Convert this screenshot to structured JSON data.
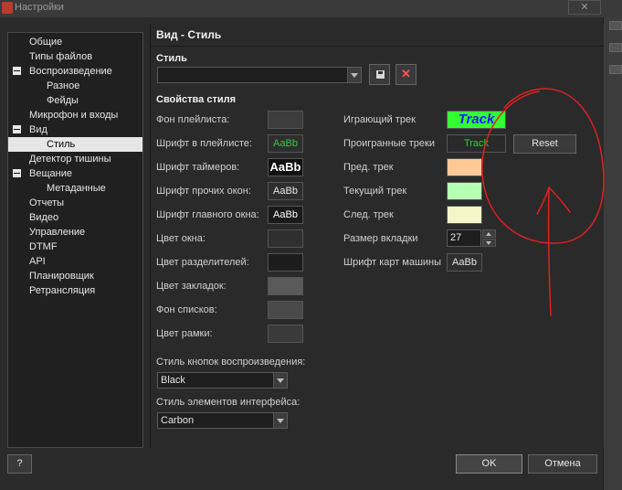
{
  "window": {
    "title": "Настройки",
    "close_icon": "close-icon"
  },
  "nav": {
    "items": [
      {
        "label": "Общие",
        "indent": 1
      },
      {
        "label": "Типы файлов",
        "indent": 1
      },
      {
        "label": "Воспроизведение",
        "indent": 1,
        "expanded": true
      },
      {
        "label": "Разное",
        "indent": 2
      },
      {
        "label": "Фейды",
        "indent": 2
      },
      {
        "label": "Микрофон и входы",
        "indent": 1
      },
      {
        "label": "Вид",
        "indent": 1,
        "expanded": true
      },
      {
        "label": "Стиль",
        "indent": 2,
        "selected": true
      },
      {
        "label": "Детектор тишины",
        "indent": 1
      },
      {
        "label": "Вещание",
        "indent": 1,
        "expanded": true
      },
      {
        "label": "Метаданные",
        "indent": 2
      },
      {
        "label": "Отчеты",
        "indent": 1
      },
      {
        "label": "Видео",
        "indent": 1
      },
      {
        "label": "Управление",
        "indent": 1
      },
      {
        "label": "DTMF",
        "indent": 1
      },
      {
        "label": "API",
        "indent": 1
      },
      {
        "label": "Планировщик",
        "indent": 1
      },
      {
        "label": "Ретрансляция",
        "indent": 1
      }
    ]
  },
  "page": {
    "title": "Вид - Стиль",
    "style_group_label": "Стиль",
    "style_combo_value": "",
    "props_group_label": "Свойства стиля"
  },
  "left_props": [
    {
      "label": "Фон плейлиста:",
      "kind": "swatch",
      "color": "#3d3d3d"
    },
    {
      "label": "Шрифт в плейлисте:",
      "kind": "font",
      "sample": "AaBb",
      "color": "#2ecc40",
      "bg": "#2e2e2e",
      "bold": false
    },
    {
      "label": "Шрифт таймеров:",
      "kind": "font",
      "sample": "AaBb",
      "color": "#ffffff",
      "bg": "#111111",
      "bold": true
    },
    {
      "label": "Шрифт прочих окон:",
      "kind": "font",
      "sample": "AaBb",
      "color": "#e6e6e6",
      "bg": "#2e2e2e",
      "bold": false
    },
    {
      "label": "Шрифт главного окна:",
      "kind": "font",
      "sample": "AaBb",
      "color": "#ffffff",
      "bg": "#1a1a1a",
      "bold": false
    },
    {
      "label": "Цвет окна:",
      "kind": "swatch",
      "color": "#2f2f2f"
    },
    {
      "label": "Цвет разделителей:",
      "kind": "swatch",
      "color": "#1c1c1c"
    },
    {
      "label": "Цвет закладок:",
      "kind": "swatch",
      "color": "#5a5a5a"
    },
    {
      "label": "Фон списков:",
      "kind": "swatch",
      "color": "#4a4a4a"
    },
    {
      "label": "Цвет рамки:",
      "kind": "swatch",
      "color": "#3a3a3a"
    }
  ],
  "right_props": {
    "playing_track": {
      "label": "Играющий трек",
      "sample": "Track",
      "color": "#1a1aff",
      "bg": "#33ff33"
    },
    "played_tracks": {
      "label": "Проигранные треки",
      "sample": "Track",
      "color": "#2ecc40",
      "bg": "#2a2a2a"
    },
    "reset_label": "Reset",
    "prev_track": {
      "label": "Пред. трек",
      "color": "#ffc896"
    },
    "current_track": {
      "label": "Текущий трек",
      "color": "#b4ffb4"
    },
    "next_track": {
      "label": "След. трек",
      "color": "#f5f5c8"
    },
    "tab_size": {
      "label": "Размер вкладки",
      "value": "27"
    },
    "cart_font": {
      "label": "Шрифт карт машины",
      "sample": "AaBb"
    }
  },
  "playback_buttons": {
    "label": "Стиль кнопок воспроизведения:",
    "value": "Black"
  },
  "ui_elements": {
    "label": "Стиль элементов интерфейса:",
    "value": "Carbon"
  },
  "footer": {
    "help": "?",
    "ok": "OK",
    "cancel": "Отмена"
  },
  "annotation_color": "#e02020"
}
